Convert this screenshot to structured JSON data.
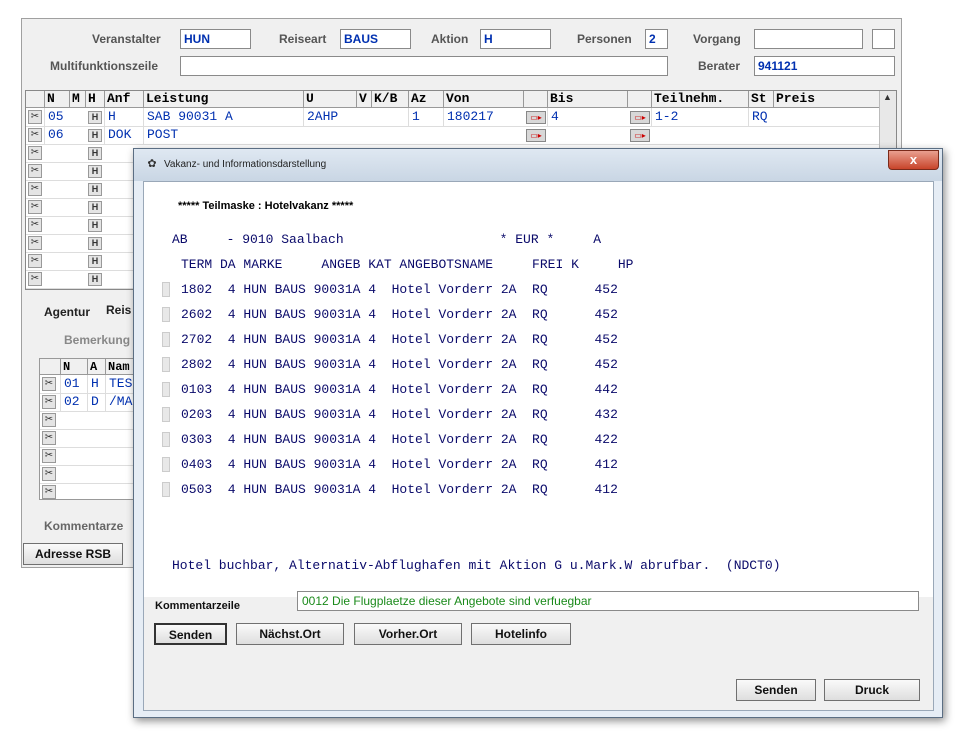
{
  "main": {
    "fields": {
      "veranstalter": {
        "label": "Veranstalter",
        "value": "HUN"
      },
      "reiseart": {
        "label": "Reiseart",
        "value": "BAUS"
      },
      "aktion": {
        "label": "Aktion",
        "value": "H"
      },
      "personen": {
        "label": "Personen",
        "value": "2"
      },
      "vorgang": {
        "label": "Vorgang",
        "value": ""
      },
      "multifunktion": {
        "label": "Multifunktionszeile",
        "value": ""
      },
      "berater": {
        "label": "Berater",
        "value": "941121"
      }
    },
    "grid": {
      "headers": [
        "N",
        "M",
        "H",
        "Anf",
        "Leistung",
        "U",
        "V",
        "K/B",
        "Az",
        "Von",
        "Bis",
        "Teilnehm.",
        "St",
        "Preis"
      ],
      "rows": [
        {
          "n": "05",
          "h": "H",
          "anf": "H",
          "leistung": "SAB 90031 A",
          "u": "2AHP",
          "az": "1",
          "von": "180217",
          "bis": "4",
          "teilnehm": "1-2",
          "st": "RQ"
        },
        {
          "n": "06",
          "h": "H",
          "anf": "DOK",
          "leistung": "POST",
          "u": "",
          "az": "",
          "von": "",
          "bis": "",
          "teilnehm": "",
          "st": ""
        }
      ],
      "h_button": "H"
    },
    "tabs": {
      "agentur": "Agentur",
      "reise": "Reis"
    },
    "bemerkung_label": "Bemerkung",
    "subgrid": {
      "headers": [
        "N",
        "A",
        "Nam"
      ],
      "rows": [
        {
          "n": "01",
          "a": "H",
          "name": "TES"
        },
        {
          "n": "02",
          "a": "D",
          "name": "/MA"
        }
      ]
    },
    "kommentar_label": "Kommentarze",
    "adresse_button": "Adresse RSB"
  },
  "dialog": {
    "title": "Vakanz- und Informationsdarstellung",
    "close_label": "x",
    "subtitle": "***** Teilmaske : Hotelvakanz *****",
    "header_line1": "AB     - 9010 Saalbach                    * EUR *     A",
    "header_line2": "TERM DA MARKE     ANGEB KAT ANGEBOTSNAME     FREI K     HP",
    "rows": [
      "1802  4 HUN BAUS 90031A 4  Hotel Vorderr 2A  RQ      452",
      "2602  4 HUN BAUS 90031A 4  Hotel Vorderr 2A  RQ      452",
      "2702  4 HUN BAUS 90031A 4  Hotel Vorderr 2A  RQ      452",
      "2802  4 HUN BAUS 90031A 4  Hotel Vorderr 2A  RQ      452",
      "0103  4 HUN BAUS 90031A 4  Hotel Vorderr 2A  RQ      442",
      "0203  4 HUN BAUS 90031A 4  Hotel Vorderr 2A  RQ      432",
      "0303  4 HUN BAUS 90031A 4  Hotel Vorderr 2A  RQ      422",
      "0403  4 HUN BAUS 90031A 4  Hotel Vorderr 2A  RQ      412",
      "0503  4 HUN BAUS 90031A 4  Hotel Vorderr 2A  RQ      412"
    ],
    "message": "Hotel buchbar, Alternativ-Abflughafen mit Aktion G u.Mark.W abrufbar.  (NDCT0)",
    "kommentar_label": "Kommentarzeile",
    "kommentar_value": "0012 Die Flugplaetze dieser Angebote sind verfuegbar",
    "buttons": {
      "senden": "Senden",
      "naechst_ort": "Nächst.Ort",
      "vorher_ort": "Vorher.Ort",
      "hotelinfo": "Hotelinfo",
      "senden2": "Senden",
      "druck": "Druck"
    }
  }
}
